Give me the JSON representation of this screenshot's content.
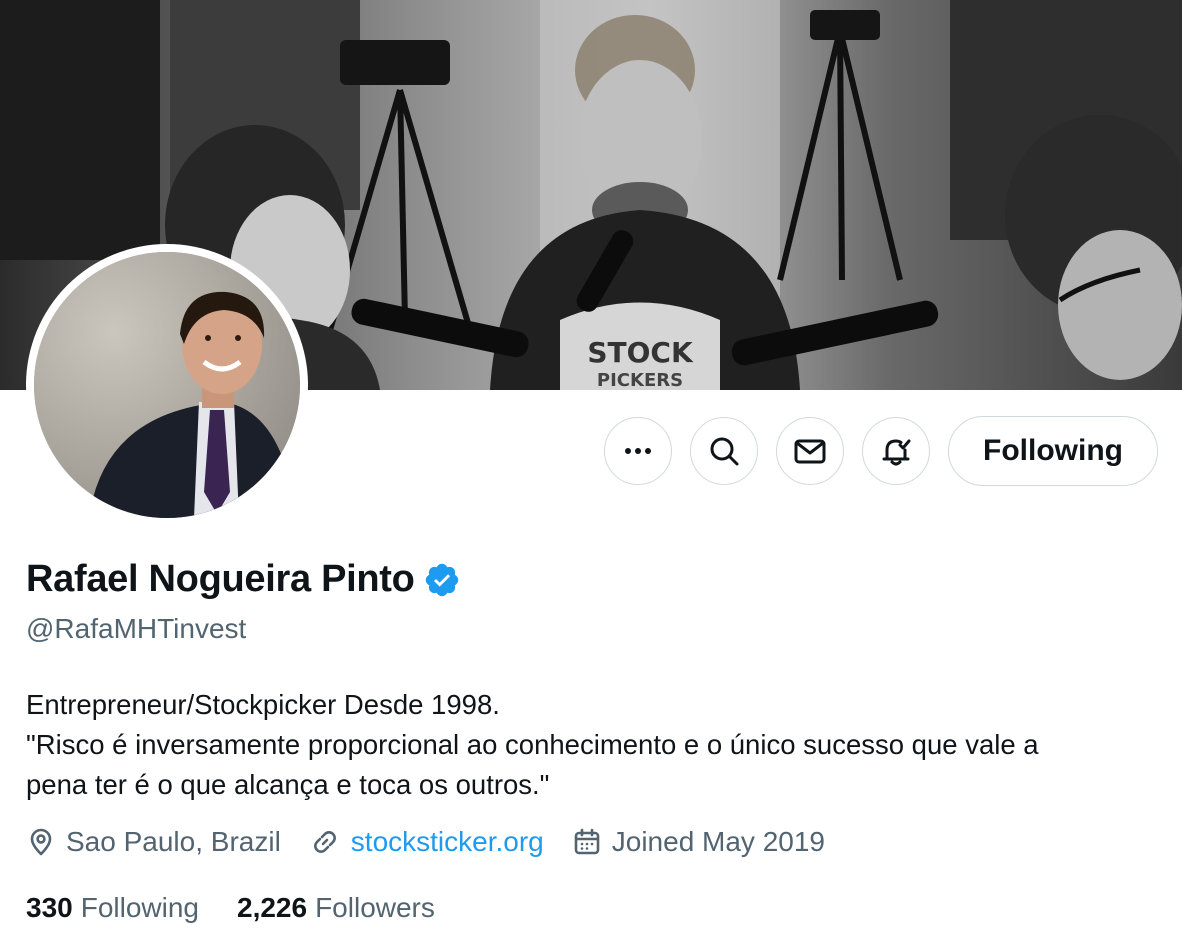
{
  "profile": {
    "display_name": "Rafael Nogueira Pinto",
    "handle": "@RafaMHTinvest",
    "verified_badge_color": "#1d9bf0",
    "bio": {
      "line1": "Entrepreneur/Stockpicker Desde 1998.",
      "line2": "\"Risco é inversamente proporcional ao conhecimento e o único sucesso que vale a",
      "line3": "pena ter é o que alcança e toca os outros.\""
    },
    "location": "Sao Paulo, Brazil",
    "website": "stocksticker.org",
    "joined": "Joined May 2019",
    "following_count": "330",
    "following_label": "Following",
    "followers_count": "2,226",
    "followers_label": "Followers"
  },
  "actions": {
    "more_icon": "more-horizontal-icon",
    "search_icon": "search-icon",
    "message_icon": "envelope-icon",
    "notify_icon": "bell-check-icon",
    "follow_label": "Following"
  },
  "banner": {
    "shirt_text_1": "STOCK",
    "shirt_text_2": "PICKERS"
  },
  "colors": {
    "accent": "#1d9bf0",
    "secondary_text": "#536471",
    "border": "#cfd9de"
  }
}
